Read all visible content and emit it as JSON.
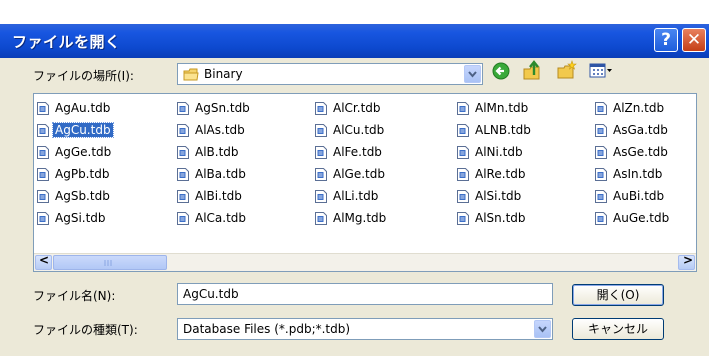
{
  "dialog": {
    "title": "ファイルを開く",
    "help_glyph": "?",
    "close_glyph": "✕"
  },
  "location": {
    "label": "ファイルの場所(I):",
    "value": "Binary"
  },
  "toolbar": {
    "icons": [
      "back-icon",
      "up-folder-icon",
      "new-folder-icon",
      "view-menu-icon"
    ]
  },
  "files": {
    "columns": [
      [
        "AgAu.tdb",
        "AgCu.tdb",
        "AgGe.tdb",
        "AgPb.tdb",
        "AgSb.tdb",
        "AgSi.tdb"
      ],
      [
        "AgSn.tdb",
        "AlAs.tdb",
        "AlB.tdb",
        "AlBa.tdb",
        "AlBi.tdb",
        "AlCa.tdb"
      ],
      [
        "AlCr.tdb",
        "AlCu.tdb",
        "AlFe.tdb",
        "AlGe.tdb",
        "AlLi.tdb",
        "AlMg.tdb"
      ],
      [
        "AlMn.tdb",
        "ALNB.tdb",
        "AlNi.tdb",
        "AlRe.tdb",
        "AlSi.tdb",
        "AlSn.tdb"
      ],
      [
        "AlZn.tdb",
        "AsGa.tdb",
        "AsGe.tdb",
        "AsIn.tdb",
        "AuBi.tdb",
        "AuGe.tdb"
      ]
    ],
    "selected": "AgCu.tdb"
  },
  "scrollbar": {
    "left_glyph": "<",
    "right_glyph": ">"
  },
  "filename": {
    "label": "ファイル名(N):",
    "value": "AgCu.tdb"
  },
  "filetype": {
    "label": "ファイルの種類(T):",
    "value": "Database Files (*.pdb;*.tdb)"
  },
  "buttons": {
    "open": "開く(O)",
    "cancel": "キャンセル"
  },
  "colors": {
    "title_bar": "#0d49cf",
    "dialog_face": "#ece9d8",
    "selection": "#316ac5"
  }
}
